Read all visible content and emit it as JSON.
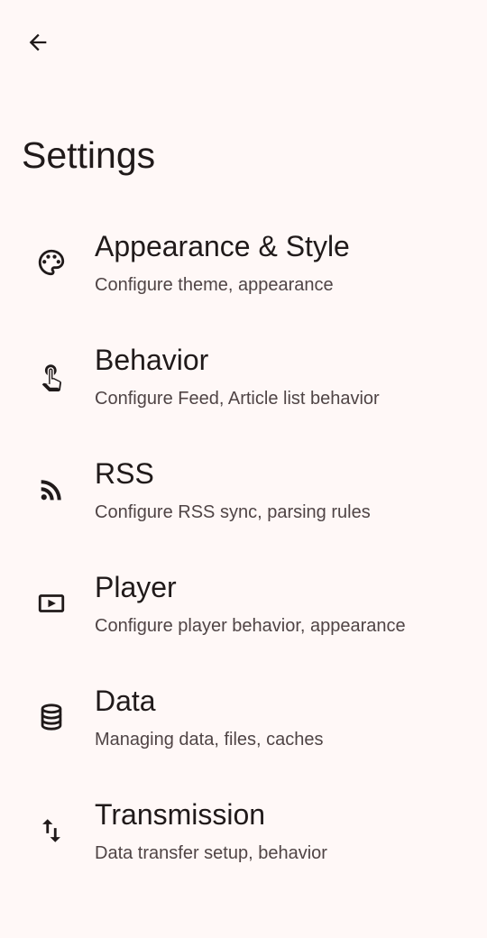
{
  "header": {
    "back_icon": "arrow-back-icon",
    "title": "Settings"
  },
  "items": [
    {
      "icon": "palette-icon",
      "title": "Appearance & Style",
      "subtitle": "Configure theme, appearance"
    },
    {
      "icon": "touch-icon",
      "title": "Behavior",
      "subtitle": "Configure Feed, Article list behavior"
    },
    {
      "icon": "rss-feed-icon",
      "title": "RSS",
      "subtitle": "Configure RSS sync, parsing rules"
    },
    {
      "icon": "play-box-icon",
      "title": "Player",
      "subtitle": "Configure player behavior, appearance"
    },
    {
      "icon": "database-icon",
      "title": "Data",
      "subtitle": "Managing data, files, caches"
    },
    {
      "icon": "swap-vert-icon",
      "title": "Transmission",
      "subtitle": "Data transfer setup, behavior"
    }
  ],
  "colors": {
    "background": "#fff8f7",
    "text_primary": "#201a1a",
    "text_secondary": "#4f4445"
  }
}
